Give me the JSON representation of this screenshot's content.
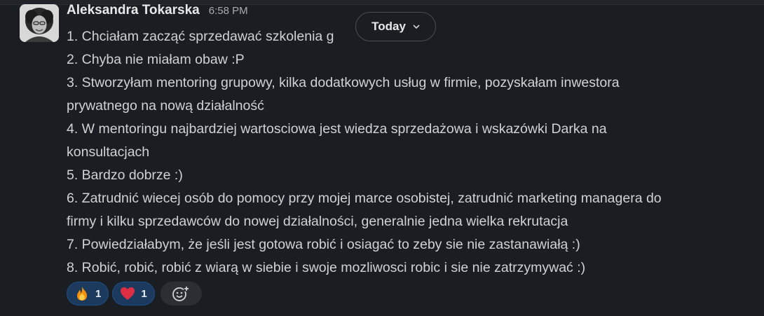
{
  "message": {
    "author": "Aleksandra Tokarska",
    "timestamp": "6:58 PM",
    "lines": [
      "1. Chciałam zacząć sprzedawać szkolenia g",
      "2. Chyba nie miałam obaw :P",
      "3. Stworzyłam mentoring grupowy, kilka dodatkowych usług w firmie, pozyskałam inwestora",
      "prywatnego na nową działalność",
      "4. W mentoringu najbardziej wartosciowa jest wiedza sprzedażowa i wskazówki Darka na",
      "konsultacjach",
      "5. Bardzo dobrze :)",
      "6. Zatrudnić wiecej osób do pomocy przy mojej marce osobistej, zatrudnić marketing managera do",
      "firmy i kilku sprzedawców do nowej działalności, generalnie jedna wielka rekrutacja",
      "7. Powiedziałabym, że jeśli jest gotowa robić i osiagać to zeby sie nie zastanawiałą :)",
      "8. Robić, robić, robić z wiarą  w siebie i swoje mozliwosci robic i sie nie zatrzymywać :)"
    ],
    "reactions": [
      {
        "icon": "fire-emoji-icon",
        "count": "1"
      },
      {
        "icon": "heart-emoji-icon",
        "count": "1"
      }
    ],
    "add_reaction_icon": "add-reaction-icon"
  },
  "date_divider": {
    "label": "Today",
    "icon": "chevron-down-icon"
  },
  "colors": {
    "background": "#1a1d21",
    "text": "#d1d2d3",
    "reaction_bg": "#1c3a5e",
    "reaction_border": "#1d4f86"
  }
}
